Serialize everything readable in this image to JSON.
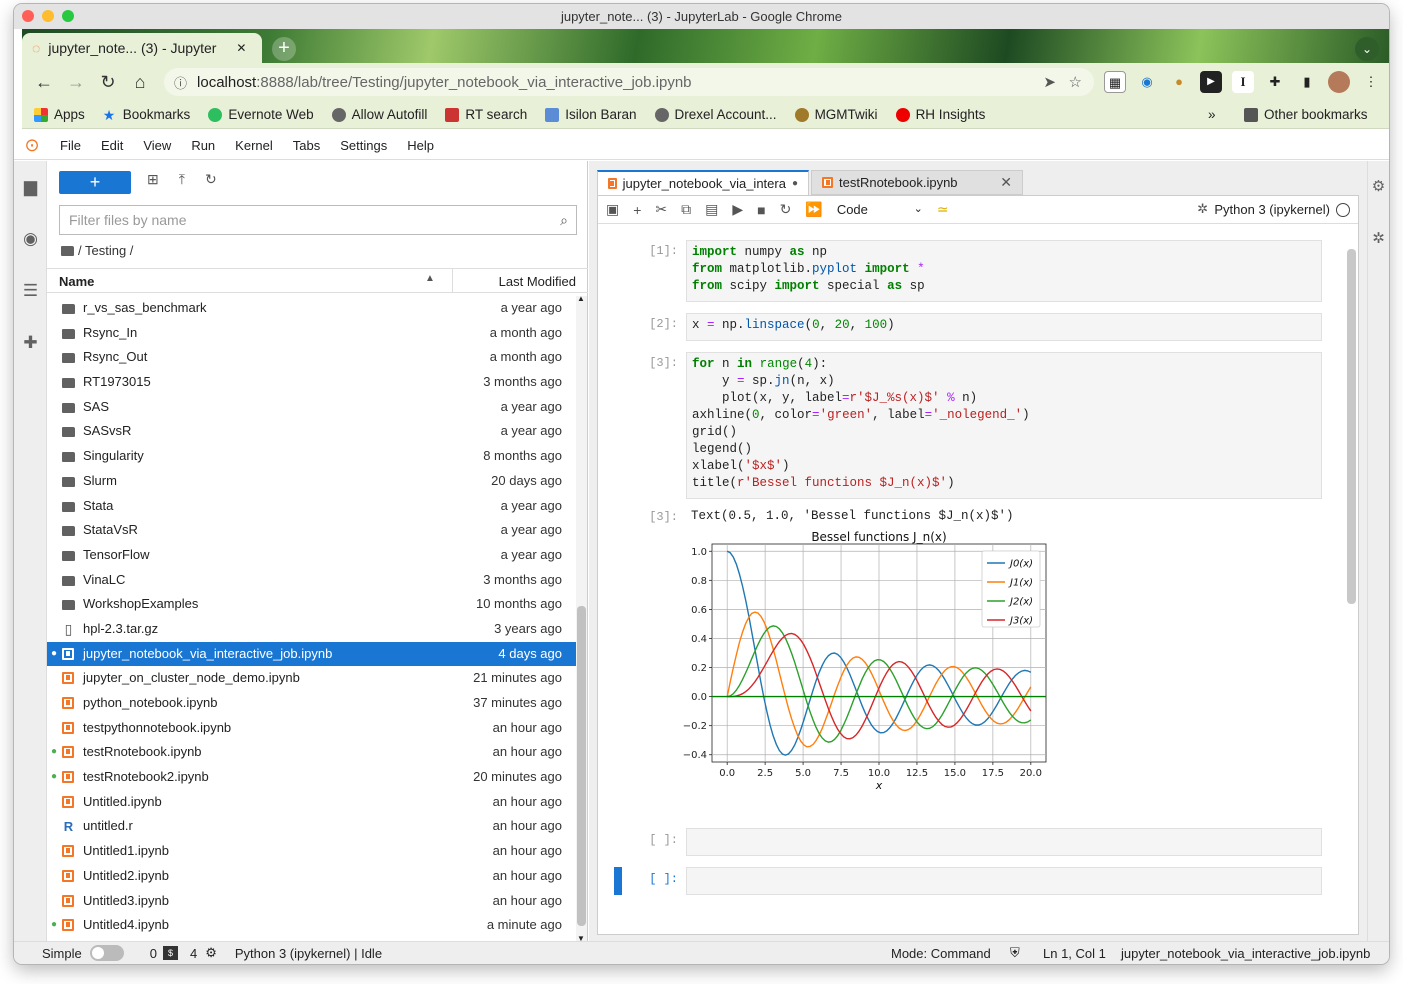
{
  "window_title": "jupyter_note... (3) - JupyterLab - Google Chrome",
  "browser": {
    "tab_title": "jupyter_note... (3) - Jupyter",
    "url_host": "localhost",
    "url_rest": ":8888/lab/tree/Testing/jupyter_notebook_via_interactive_job.ipynb",
    "bookmarks": [
      "Apps",
      "Bookmarks",
      "Evernote Web",
      "Allow Autofill",
      "RT search",
      "Isilon Baran",
      "Drexel Account...",
      "MGMTwiki",
      "RH Insights"
    ],
    "more": "»",
    "other_bookmarks": "Other bookmarks"
  },
  "menu": [
    "File",
    "Edit",
    "View",
    "Run",
    "Kernel",
    "Tabs",
    "Settings",
    "Help"
  ],
  "filebrowser": {
    "new_label": "+",
    "filter_placeholder": "Filter files by name",
    "breadcrumb": "/ Testing /",
    "col_name": "Name",
    "col_modified": "Last Modified",
    "files": [
      {
        "name": "r_vs_sas_benchmark",
        "modified": "a year ago",
        "type": "folder"
      },
      {
        "name": "Rsync_In",
        "modified": "a month ago",
        "type": "folder"
      },
      {
        "name": "Rsync_Out",
        "modified": "a month ago",
        "type": "folder"
      },
      {
        "name": "RT1973015",
        "modified": "3 months ago",
        "type": "folder"
      },
      {
        "name": "SAS",
        "modified": "a year ago",
        "type": "folder"
      },
      {
        "name": "SASvsR",
        "modified": "a year ago",
        "type": "folder"
      },
      {
        "name": "Singularity",
        "modified": "8 months ago",
        "type": "folder"
      },
      {
        "name": "Slurm",
        "modified": "20 days ago",
        "type": "folder"
      },
      {
        "name": "Stata",
        "modified": "a year ago",
        "type": "folder"
      },
      {
        "name": "StataVsR",
        "modified": "a year ago",
        "type": "folder"
      },
      {
        "name": "TensorFlow",
        "modified": "a year ago",
        "type": "folder"
      },
      {
        "name": "VinaLC",
        "modified": "3 months ago",
        "type": "folder"
      },
      {
        "name": "WorkshopExamples",
        "modified": "10 months ago",
        "type": "folder"
      },
      {
        "name": "hpl-2.3.tar.gz",
        "modified": "3 years ago",
        "type": "file"
      },
      {
        "name": "jupyter_notebook_via_interactive_job.ipynb",
        "modified": "4 days ago",
        "type": "notebook",
        "selected": true,
        "running": true
      },
      {
        "name": "jupyter_on_cluster_node_demo.ipynb",
        "modified": "21 minutes ago",
        "type": "notebook"
      },
      {
        "name": "python_notebook.ipynb",
        "modified": "37 minutes ago",
        "type": "notebook"
      },
      {
        "name": "testpythonnotebook.ipynb",
        "modified": "an hour ago",
        "type": "notebook"
      },
      {
        "name": "testRnotebook.ipynb",
        "modified": "an hour ago",
        "type": "notebook",
        "running": true
      },
      {
        "name": "testRnotebook2.ipynb",
        "modified": "20 minutes ago",
        "type": "notebook",
        "running": true
      },
      {
        "name": "Untitled.ipynb",
        "modified": "an hour ago",
        "type": "notebook"
      },
      {
        "name": "untitled.r",
        "modified": "an hour ago",
        "type": "r"
      },
      {
        "name": "Untitled1.ipynb",
        "modified": "an hour ago",
        "type": "notebook"
      },
      {
        "name": "Untitled2.ipynb",
        "modified": "an hour ago",
        "type": "notebook"
      },
      {
        "name": "Untitled3.ipynb",
        "modified": "an hour ago",
        "type": "notebook"
      },
      {
        "name": "Untitled4.ipynb",
        "modified": "a minute ago",
        "type": "notebook",
        "running": true
      }
    ]
  },
  "doc_tabs": [
    {
      "label": "jupyter_notebook_via_intera",
      "active": true
    },
    {
      "label": "testRnotebook.ipynb",
      "active": false
    }
  ],
  "notebook": {
    "cell_type": "Code",
    "kernel": "Python 3 (ipykernel)",
    "prompts": [
      "[1]:",
      "[2]:",
      "[3]:",
      "[3]:",
      "[ ]:",
      "[ ]:"
    ],
    "output_text": "Text(0.5, 1.0, 'Bessel functions $J_n(x)$')"
  },
  "chart_data": {
    "type": "line",
    "title": "Bessel functions J_n(x)",
    "xlabel": "x",
    "ylabel": "",
    "xlim": [
      -1,
      21
    ],
    "ylim": [
      -0.45,
      1.05
    ],
    "xticks": [
      "0.0",
      "2.5",
      "5.0",
      "7.5",
      "10.0",
      "12.5",
      "15.0",
      "17.5",
      "20.0"
    ],
    "yticks": [
      "−0.4",
      "−0.2",
      "0.0",
      "0.2",
      "0.4",
      "0.6",
      "0.8",
      "1.0"
    ],
    "grid": true,
    "legend": "top-right",
    "series": [
      {
        "name": "J0(x)",
        "color": "#1f77b4",
        "order": 0
      },
      {
        "name": "J1(x)",
        "color": "#ff7f0e",
        "order": 1
      },
      {
        "name": "J2(x)",
        "color": "#2ca02c",
        "order": 2
      },
      {
        "name": "J3(x)",
        "color": "#d62728",
        "order": 3
      }
    ],
    "x": {
      "start": 0,
      "stop": 20,
      "num": 100
    },
    "hline": {
      "y": 0,
      "color": "green"
    }
  },
  "status": {
    "mode_label": "Simple",
    "terminals": "0",
    "kernels": "4",
    "kernel_status": "Python 3 (ipykernel) | Idle",
    "mode": "Mode: Command",
    "position": "Ln 1, Col 1",
    "filename": "jupyter_notebook_via_interactive_job.ipynb"
  }
}
